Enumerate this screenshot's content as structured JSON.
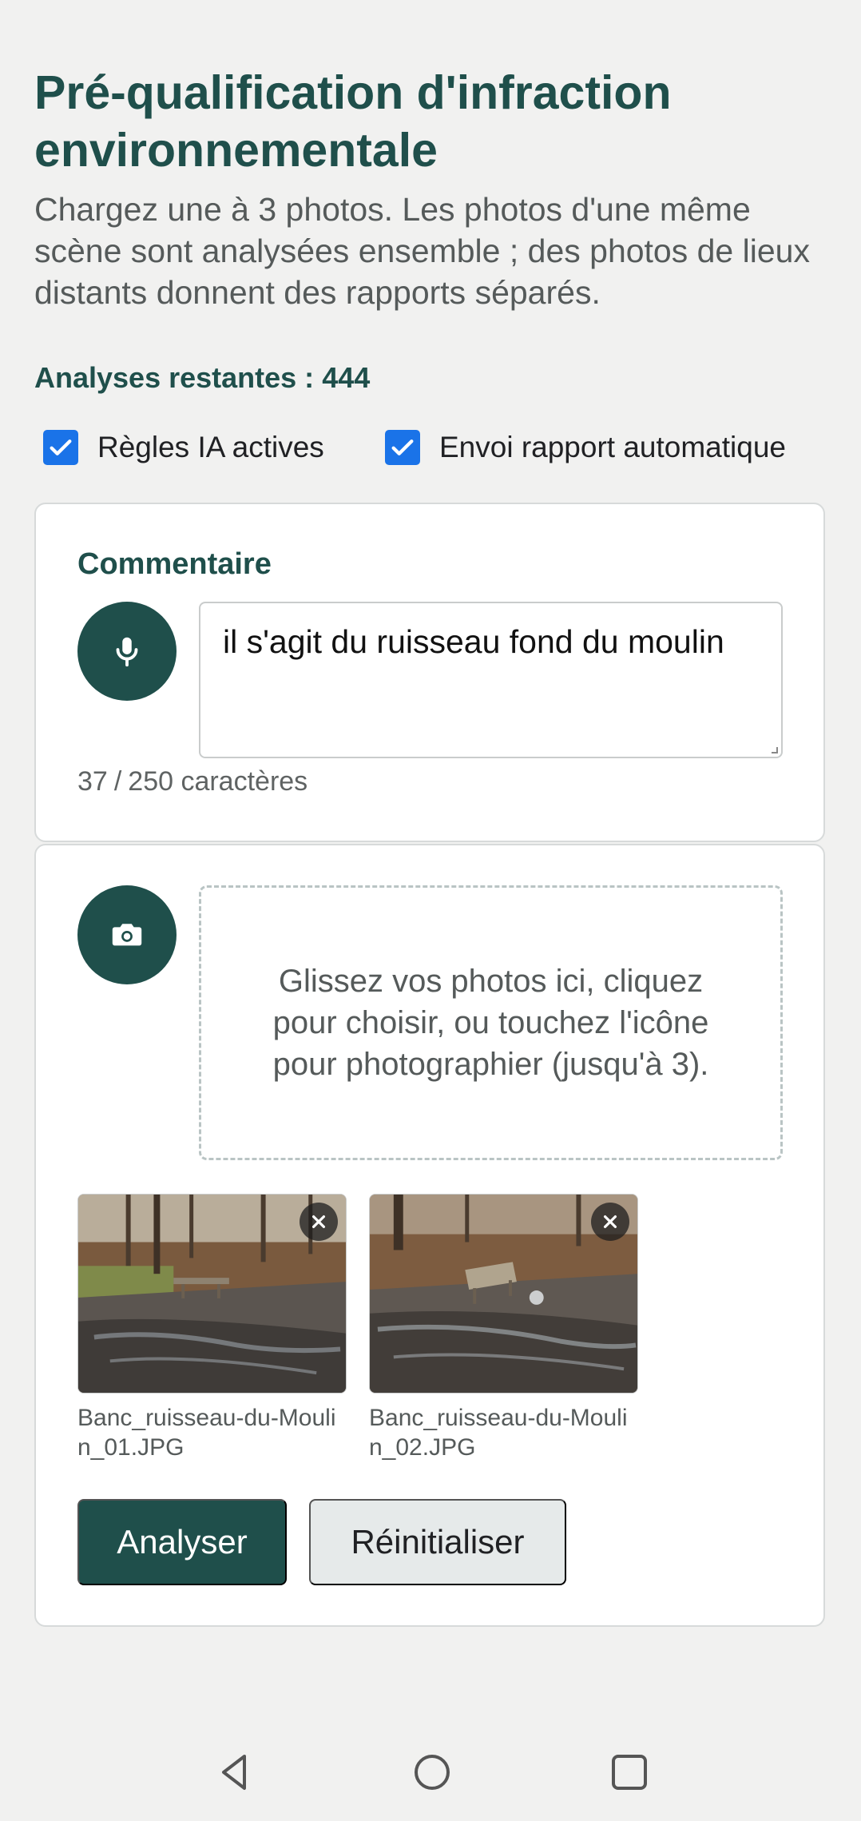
{
  "header": {
    "title": "Pré-qualification d'infraction environnementale",
    "subtitle": "Chargez une à 3 photos. Les photos d'une même scène sont analysées ensemble ; des photos de lieux distants donnent des rapports séparés."
  },
  "quota": {
    "label": "Analyses restantes :",
    "value": "444"
  },
  "options": {
    "ai_rules": {
      "label": "Règles IA actives",
      "checked": true
    },
    "auto_report": {
      "label": "Envoi rapport automatique",
      "checked": true
    }
  },
  "comment": {
    "label": "Commentaire",
    "value": "il s'agit du ruisseau  fond du moulin",
    "char_count": "37",
    "char_max": "250 caractères",
    "mic_icon": "microphone-icon"
  },
  "photos": {
    "camera_icon": "camera-icon",
    "drop_hint": "Glissez vos photos ici, cliquez pour choisir, ou touchez l'icône pour photographier (jusqu'à 3).",
    "items": [
      {
        "filename": "Banc_ruisseau-du-Moulin_01.JPG"
      },
      {
        "filename": "Banc_ruisseau-du-Moulin_02.JPG"
      }
    ]
  },
  "actions": {
    "analyze_label": "Analyser",
    "reset_label": "Réinitialiser"
  },
  "colors": {
    "primary": "#1f4f4b",
    "checkbox": "#1a73e8",
    "background": "#f1f1f0"
  }
}
